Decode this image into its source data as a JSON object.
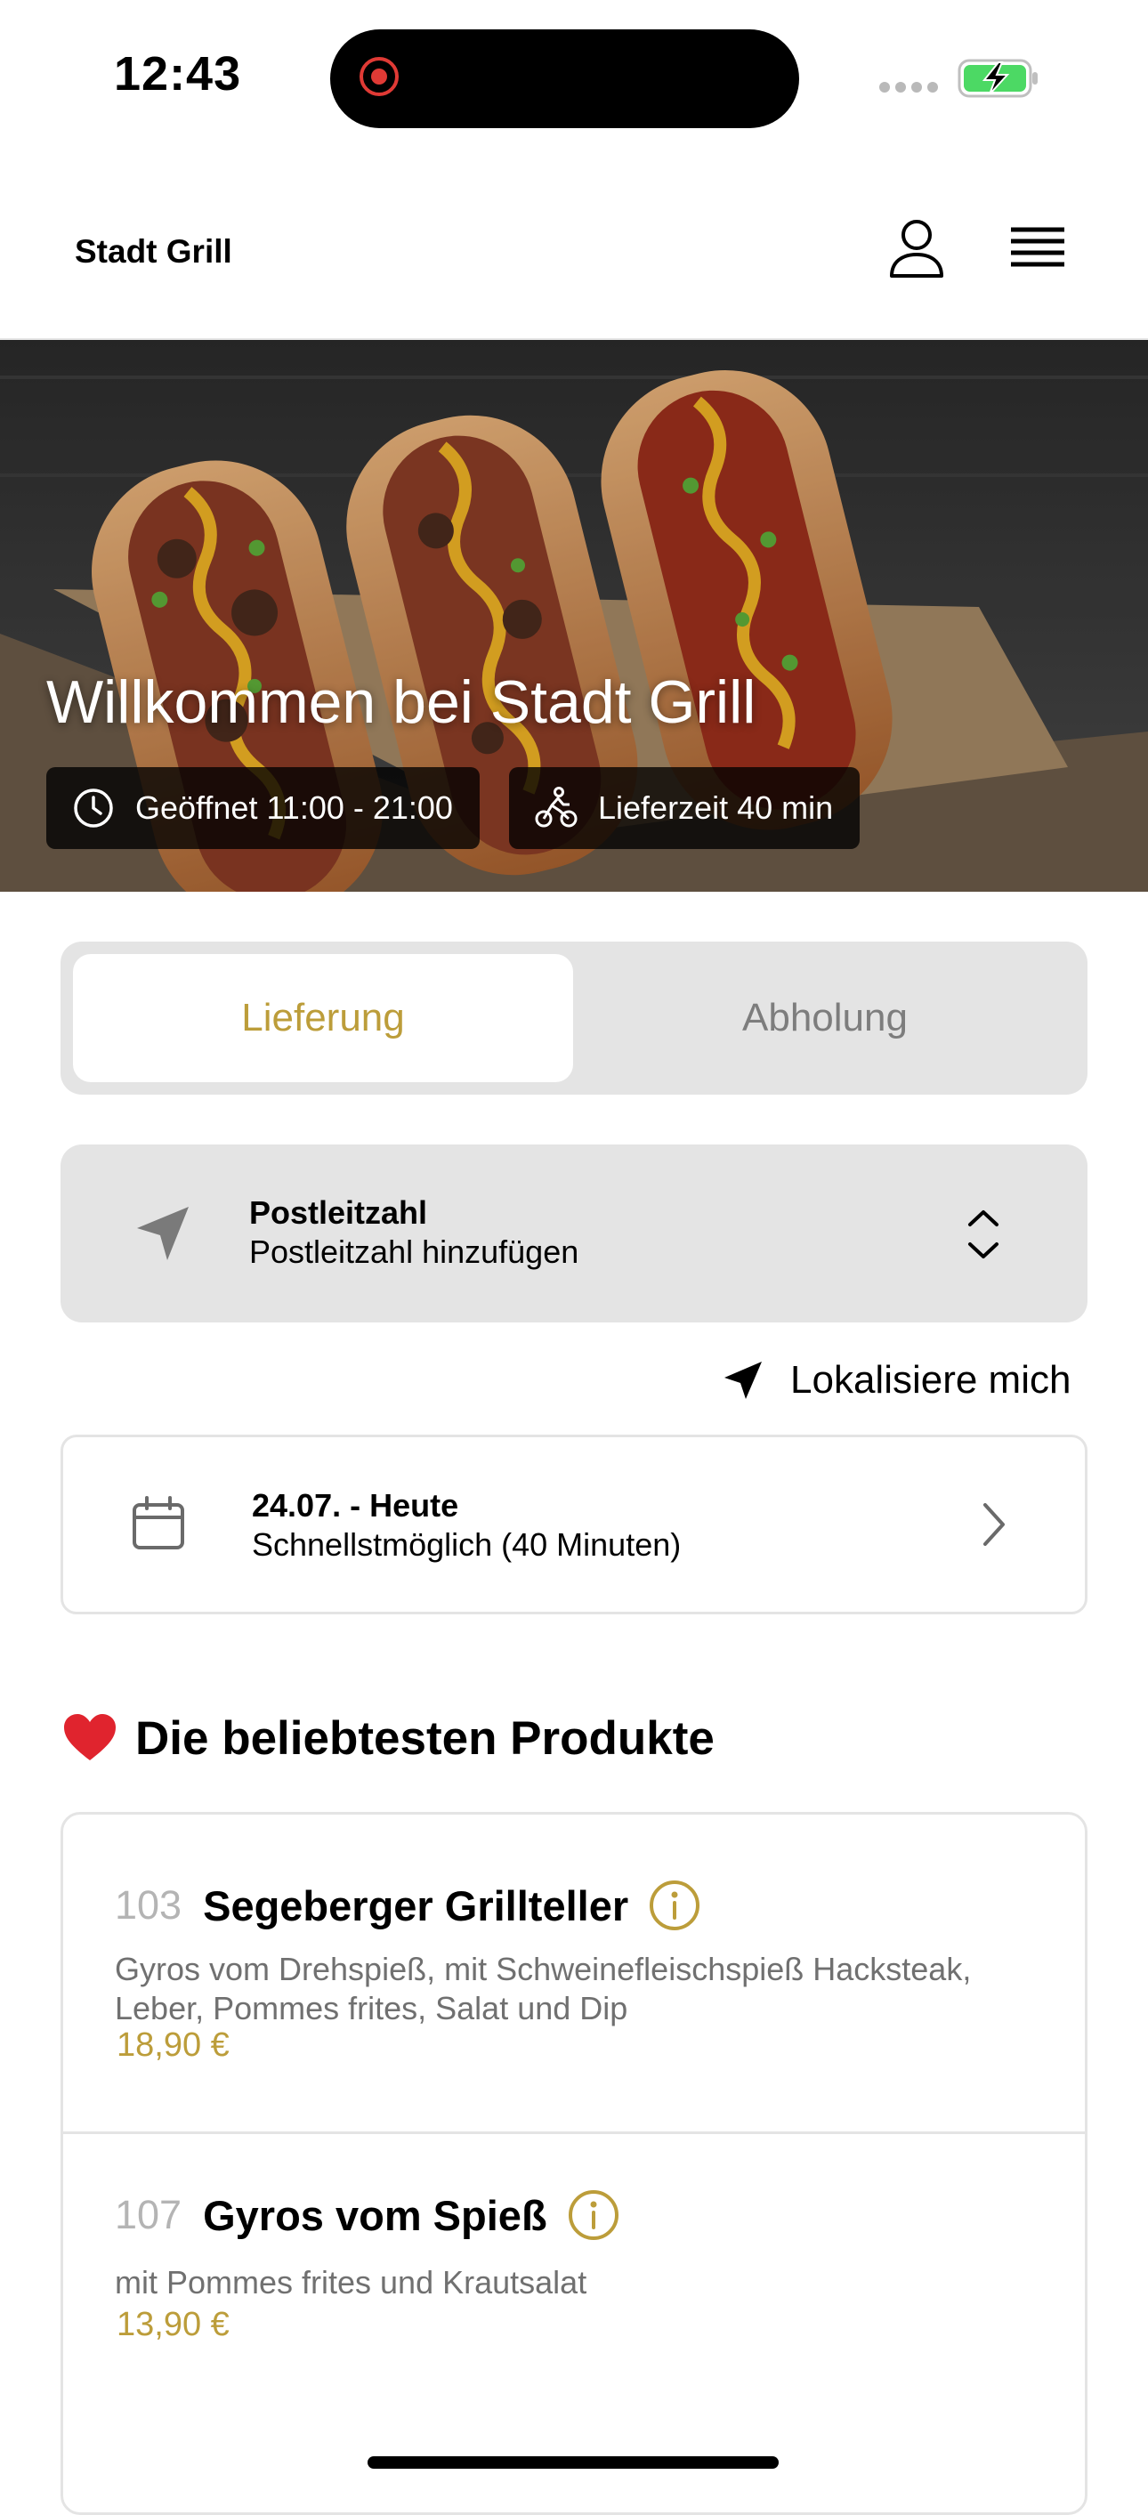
{
  "status_bar": {
    "time": "12:43"
  },
  "header": {
    "brand": "Stadt Grill",
    "profile_icon": "user-icon",
    "menu_icon": "hamburger-menu-icon"
  },
  "hero": {
    "title": "Willkommen bei Stadt Grill",
    "opening_hours": "Geöffnet 11:00 - 21:00",
    "delivery_time": "Lieferzeit 40 min"
  },
  "order_mode": {
    "tabs": [
      "Lieferung",
      "Abholung"
    ],
    "selected": "Lieferung"
  },
  "postcode": {
    "label": "Postleitzahl",
    "placeholder": "Postleitzahl hinzufügen"
  },
  "locate": {
    "label": "Lokalisiere mich"
  },
  "schedule": {
    "date": "24.07. - Heute",
    "time": "Schnellstmöglich (40 Minuten)"
  },
  "popular": {
    "title": "Die beliebtesten Produkte",
    "products": [
      {
        "number": "103",
        "name": "Segeberger Grillteller",
        "description": "Gyros vom Drehspieß, mit Schweinefleischspieß Hacksteak, Leber, Pommes frites, Salat und Dip",
        "price": "18,90 €"
      },
      {
        "number": "107",
        "name": "Gyros vom Spieß",
        "description": "mit Pommes frites und Krautsalat",
        "price": "13,90 €"
      }
    ]
  },
  "colors": {
    "accent": "#bc9d3a",
    "panel": "#e4e4e4",
    "recording": "#e03a35",
    "battery": "#4cd964"
  }
}
